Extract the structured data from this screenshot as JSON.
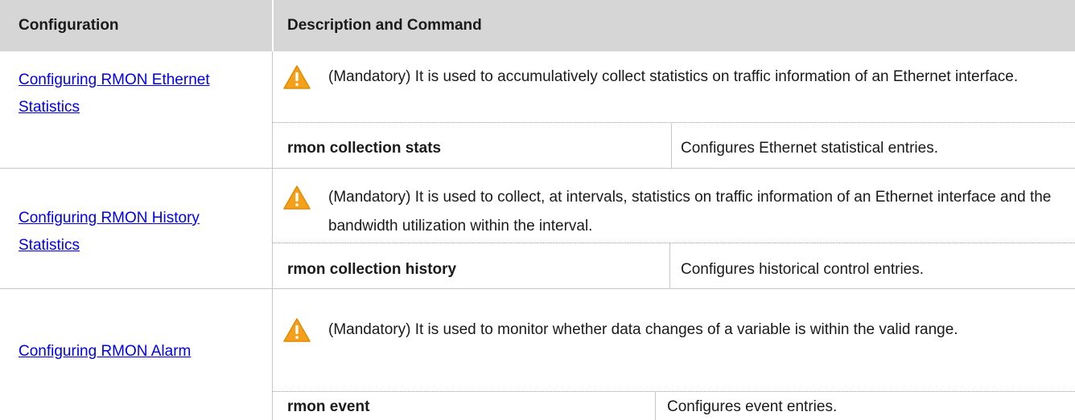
{
  "header": {
    "col1": "Configuration",
    "col2": "Description and Command"
  },
  "rows": [
    {
      "config": "Configuring RMON Ethernet Statistics",
      "note": "(Mandatory) It is used to accumulatively collect statistics on traffic information of an Ethernet interface.",
      "command": "rmon collection stats",
      "command_desc": "Configures Ethernet statistical entries."
    },
    {
      "config": "Configuring RMON History Statistics",
      "note": "(Mandatory) It is used to collect, at intervals, statistics on traffic information of an Ethernet interface and the bandwidth utilization within the interval.",
      "command": "rmon collection history",
      "command_desc": "Configures historical control entries."
    },
    {
      "config": "Configuring RMON Alarm",
      "note": "(Mandatory) It is used to monitor whether data changes of a variable is within the valid range.",
      "command": "rmon event",
      "command_desc": "Configures event entries."
    }
  ],
  "icons": {
    "note_icon": "warning-icon"
  },
  "colors": {
    "header_bg": "#d6d6d6",
    "link": "#0000ee",
    "warning": "#f5a01a"
  }
}
